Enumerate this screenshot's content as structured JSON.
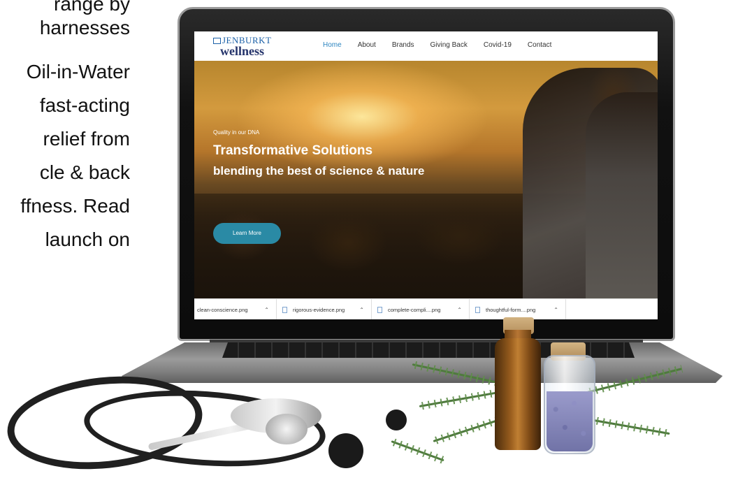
{
  "side_text": {
    "lines": [
      "range by",
      "harnesses",
      "Oil-in-Water",
      "fast-acting",
      "relief from",
      "cle & back",
      "ffness. Read",
      "launch on"
    ]
  },
  "site": {
    "logo_brand": "JENBURKT",
    "logo_sub": "wellness",
    "nav": [
      {
        "label": "Home",
        "active": true
      },
      {
        "label": "About",
        "active": false
      },
      {
        "label": "Brands",
        "active": false
      },
      {
        "label": "Giving Back",
        "active": false
      },
      {
        "label": "Covid-19",
        "active": false
      },
      {
        "label": "Contact",
        "active": false
      }
    ],
    "hero": {
      "kicker": "Quality in our DNA",
      "title": "Transformative Solutions",
      "subtitle": "blending the best of science & nature",
      "button": "Learn More"
    }
  },
  "downloads": [
    {
      "file": "clean-conscience.png"
    },
    {
      "file": "rigorous-evidence.png"
    },
    {
      "file": "complete-compli....png"
    },
    {
      "file": "thoughtful-form....png"
    }
  ],
  "colors": {
    "nav_active": "#2e86c1",
    "button": "#2a8aa5",
    "logo": "#25346b"
  },
  "icons": {
    "download_chevron": "chevron-up-icon",
    "download_file": "file-icon"
  }
}
